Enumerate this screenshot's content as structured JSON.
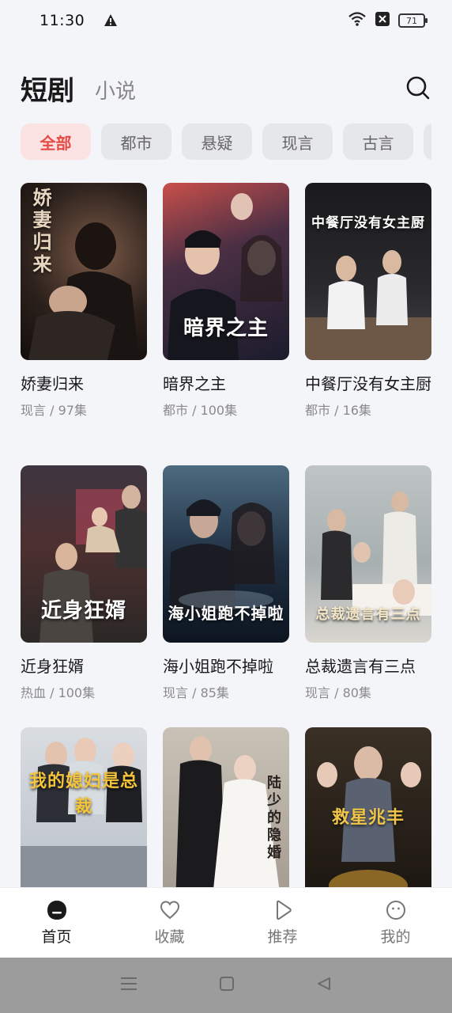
{
  "status": {
    "time": "11:30",
    "battery": "71"
  },
  "header": {
    "tab_active": "短剧",
    "tab_inactive": "小说"
  },
  "chips": [
    "全部",
    "都市",
    "悬疑",
    "现言",
    "古言"
  ],
  "cards": [
    {
      "title": "娇妻归来",
      "meta": "现言 / 97集",
      "poster_text": "娇妻归来"
    },
    {
      "title": "暗界之主",
      "meta": "都市 / 100集",
      "poster_text": "暗界之主"
    },
    {
      "title": "中餐厅没有女主厨",
      "meta": "都市 / 16集",
      "poster_text": "中餐厅没有女主厨"
    },
    {
      "title": "近身狂婿",
      "meta": "热血 / 100集",
      "poster_text": "近身狂婿"
    },
    {
      "title": "海小姐跑不掉啦",
      "meta": "现言 / 85集",
      "poster_text": "海小姐跑不掉啦"
    },
    {
      "title": "总裁遗言有三点",
      "meta": "现言 / 80集",
      "poster_text": "总裁遗言有三点"
    },
    {
      "title": "",
      "meta": "",
      "poster_text": "我的媳妇是总裁"
    },
    {
      "title": "",
      "meta": "",
      "poster_text": "陆少的隐婚"
    },
    {
      "title": "",
      "meta": "",
      "poster_text": "救星兆丰"
    }
  ],
  "nav": [
    {
      "label": "首页",
      "icon": "home-icon"
    },
    {
      "label": "收藏",
      "icon": "heart-icon"
    },
    {
      "label": "推荐",
      "icon": "play-icon"
    },
    {
      "label": "我的",
      "icon": "profile-icon"
    }
  ]
}
